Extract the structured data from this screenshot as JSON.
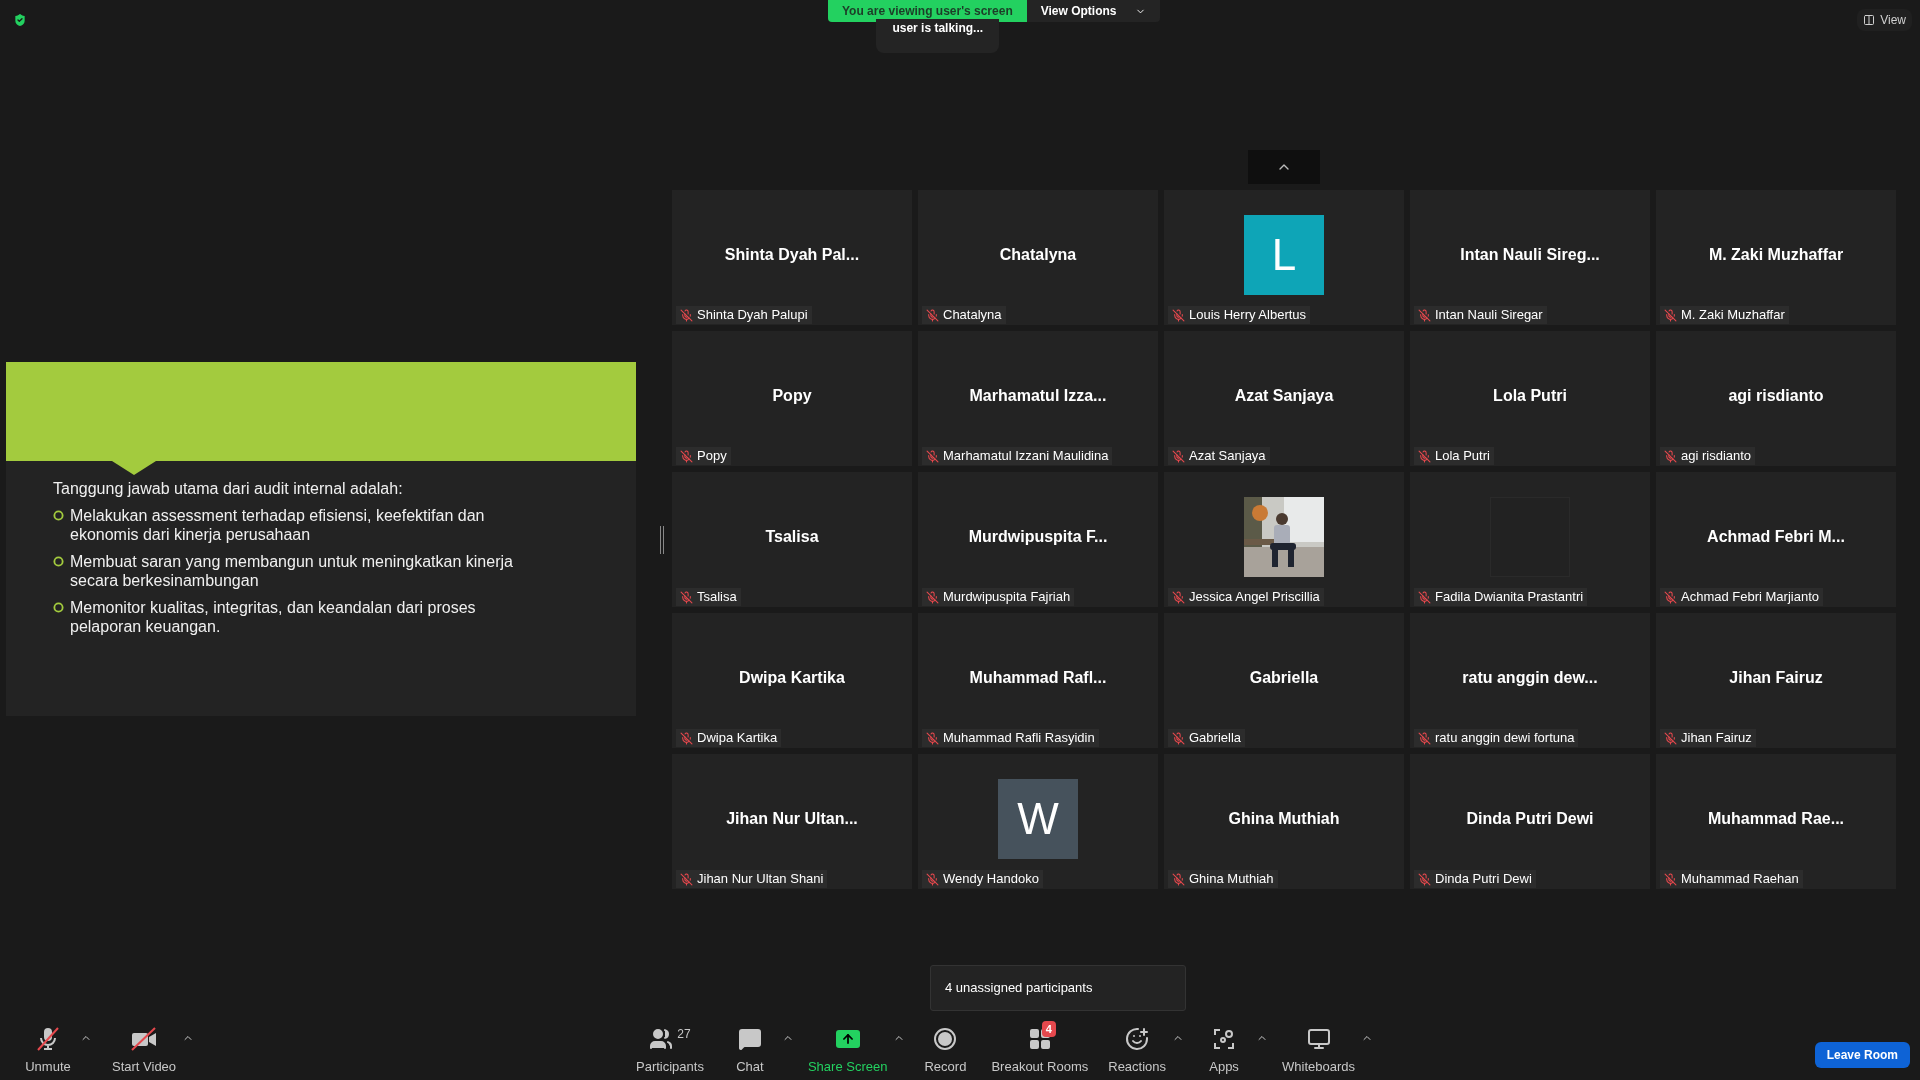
{
  "top_bar": {
    "banner": "You are viewing user's screen",
    "view_options": "View Options",
    "talking_indicator": "user is talking...",
    "view_button": "View"
  },
  "slide": {
    "heading": "Tanggung jawab utama dari audit internal adalah:",
    "bullets": [
      "Melakukan assessment terhadap efisiensi, keefektifan dan ekonomis dari kinerja perusahaan",
      "Membuat saran yang membangun untuk meningkatkan kinerja secara berkesinambungan",
      "Memonitor kualitas, integritas, dan keandalan dari proses pelaporan keuangan."
    ]
  },
  "gallery": {
    "tiles": [
      {
        "kind": "name",
        "display": "Shinta Dyah Pal...",
        "name": "Shinta Dyah Palupi",
        "muted": true
      },
      {
        "kind": "name",
        "display": "Chatalyna",
        "name": "Chatalyna",
        "muted": true
      },
      {
        "kind": "letter",
        "display": "L",
        "color": "#0ea5b7",
        "name": "Louis Herry Albertus",
        "muted": true
      },
      {
        "kind": "name",
        "display": "Intan Nauli Sireg...",
        "name": "Intan Nauli Siregar",
        "muted": true
      },
      {
        "kind": "name",
        "display": "M. Zaki Muzhaffar",
        "name": "M. Zaki Muzhaffar",
        "muted": true
      },
      {
        "kind": "name",
        "display": "Popy",
        "name": "Popy",
        "muted": true
      },
      {
        "kind": "name",
        "display": "Marhamatul Izza...",
        "name": "Marhamatul Izzani Maulidina",
        "muted": true
      },
      {
        "kind": "name",
        "display": "Azat Sanjaya",
        "name": "Azat Sanjaya",
        "muted": true
      },
      {
        "kind": "name",
        "display": "Lola Putri",
        "name": "Lola Putri",
        "muted": true
      },
      {
        "kind": "name",
        "display": "agi risdianto",
        "name": "agi risdianto",
        "muted": true
      },
      {
        "kind": "name",
        "display": "Tsalisa",
        "name": "Tsalisa",
        "muted": true
      },
      {
        "kind": "name",
        "display": "Murdwipuspita F...",
        "name": "Murdwipuspita Fajriah",
        "muted": true
      },
      {
        "kind": "picture",
        "name": "Jessica Angel Priscillia",
        "muted": true
      },
      {
        "kind": "blank",
        "name": "Fadila Dwianita Prastantri",
        "muted": true
      },
      {
        "kind": "name",
        "display": "Achmad Febri M...",
        "name": "Achmad Febri Marjianto",
        "muted": true
      },
      {
        "kind": "name",
        "display": "Dwipa Kartika",
        "name": "Dwipa Kartika",
        "muted": true
      },
      {
        "kind": "name",
        "display": "Muhammad Rafl...",
        "name": "Muhammad Rafli Rasyidin",
        "muted": true
      },
      {
        "kind": "name",
        "display": "Gabriella",
        "name": "Gabriella",
        "muted": true
      },
      {
        "kind": "name",
        "display": "ratu anggin dew...",
        "name": "ratu anggin dewi fortuna",
        "muted": true
      },
      {
        "kind": "name",
        "display": "Jihan Fairuz",
        "name": "Jihan Fairuz",
        "muted": true
      },
      {
        "kind": "name",
        "display": "Jihan Nur Ultan...",
        "name": "Jihan Nur Ultan Shani",
        "muted": true
      },
      {
        "kind": "letter",
        "display": "W",
        "color": "#46525c",
        "name": "Wendy Handoko",
        "muted": true
      },
      {
        "kind": "name",
        "display": "Ghina Muthiah",
        "name": "Ghina Muthiah",
        "muted": true
      },
      {
        "kind": "name",
        "display": "Dinda Putri Dewi",
        "name": "Dinda Putri Dewi",
        "muted": true
      },
      {
        "kind": "name",
        "display": "Muhammad Rae...",
        "name": "Muhammad Raehan",
        "muted": true
      }
    ]
  },
  "toolbar": {
    "left": [
      {
        "kind": "unmute",
        "label": "Unmute",
        "caret": true
      },
      {
        "kind": "video",
        "label": "Start Video",
        "caret": true
      }
    ],
    "center": [
      {
        "kind": "participants",
        "label": "Participants",
        "count": "27",
        "caret": false
      },
      {
        "kind": "chat",
        "label": "Chat",
        "caret": true
      },
      {
        "kind": "share",
        "label": "Share Screen",
        "caret": true
      },
      {
        "kind": "record",
        "label": "Record",
        "caret": false
      },
      {
        "kind": "breakout",
        "label": "Breakout Rooms",
        "badge": "4",
        "caret": false
      },
      {
        "kind": "reactions",
        "label": "Reactions",
        "caret": true
      },
      {
        "kind": "apps",
        "label": "Apps",
        "caret": true
      },
      {
        "kind": "whiteboards",
        "label": "Whiteboards",
        "caret": true
      }
    ],
    "tooltip": "4 unassigned participants",
    "leave_button": "Leave Room"
  }
}
